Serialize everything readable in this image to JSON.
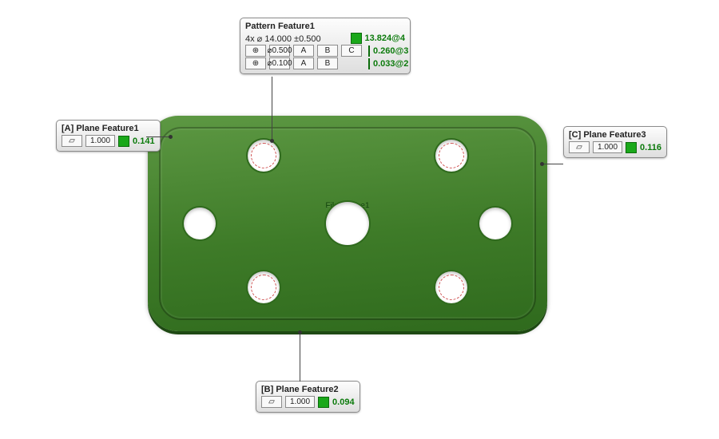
{
  "part": {
    "label": "File Device1"
  },
  "features": {
    "patternFeature1": {
      "title": "Pattern Feature1",
      "count_spec": "4x  ⌀ 14.000 ±0.500",
      "measured_top": "13.824@4",
      "rows": [
        {
          "sym": "⊕",
          "tol": "⌀0.500",
          "datums": [
            "A",
            "B",
            "C"
          ],
          "val": "0.260@3"
        },
        {
          "sym": "⊕",
          "tol": "⌀0.100",
          "datums": [
            "A",
            "B"
          ],
          "val": "0.033@2"
        }
      ]
    },
    "planeA": {
      "title": "[A] Plane Feature1",
      "sym": "▱",
      "tol": "1.000",
      "val": "0.141"
    },
    "planeB": {
      "title": "[B] Plane Feature2",
      "sym": "▱",
      "tol": "1.000",
      "val": "0.094"
    },
    "planeC": {
      "title": "[C] Plane Feature3",
      "sym": "▱",
      "tol": "1.000",
      "val": "0.116"
    }
  },
  "colors": {
    "pass": "#1aa81a"
  }
}
